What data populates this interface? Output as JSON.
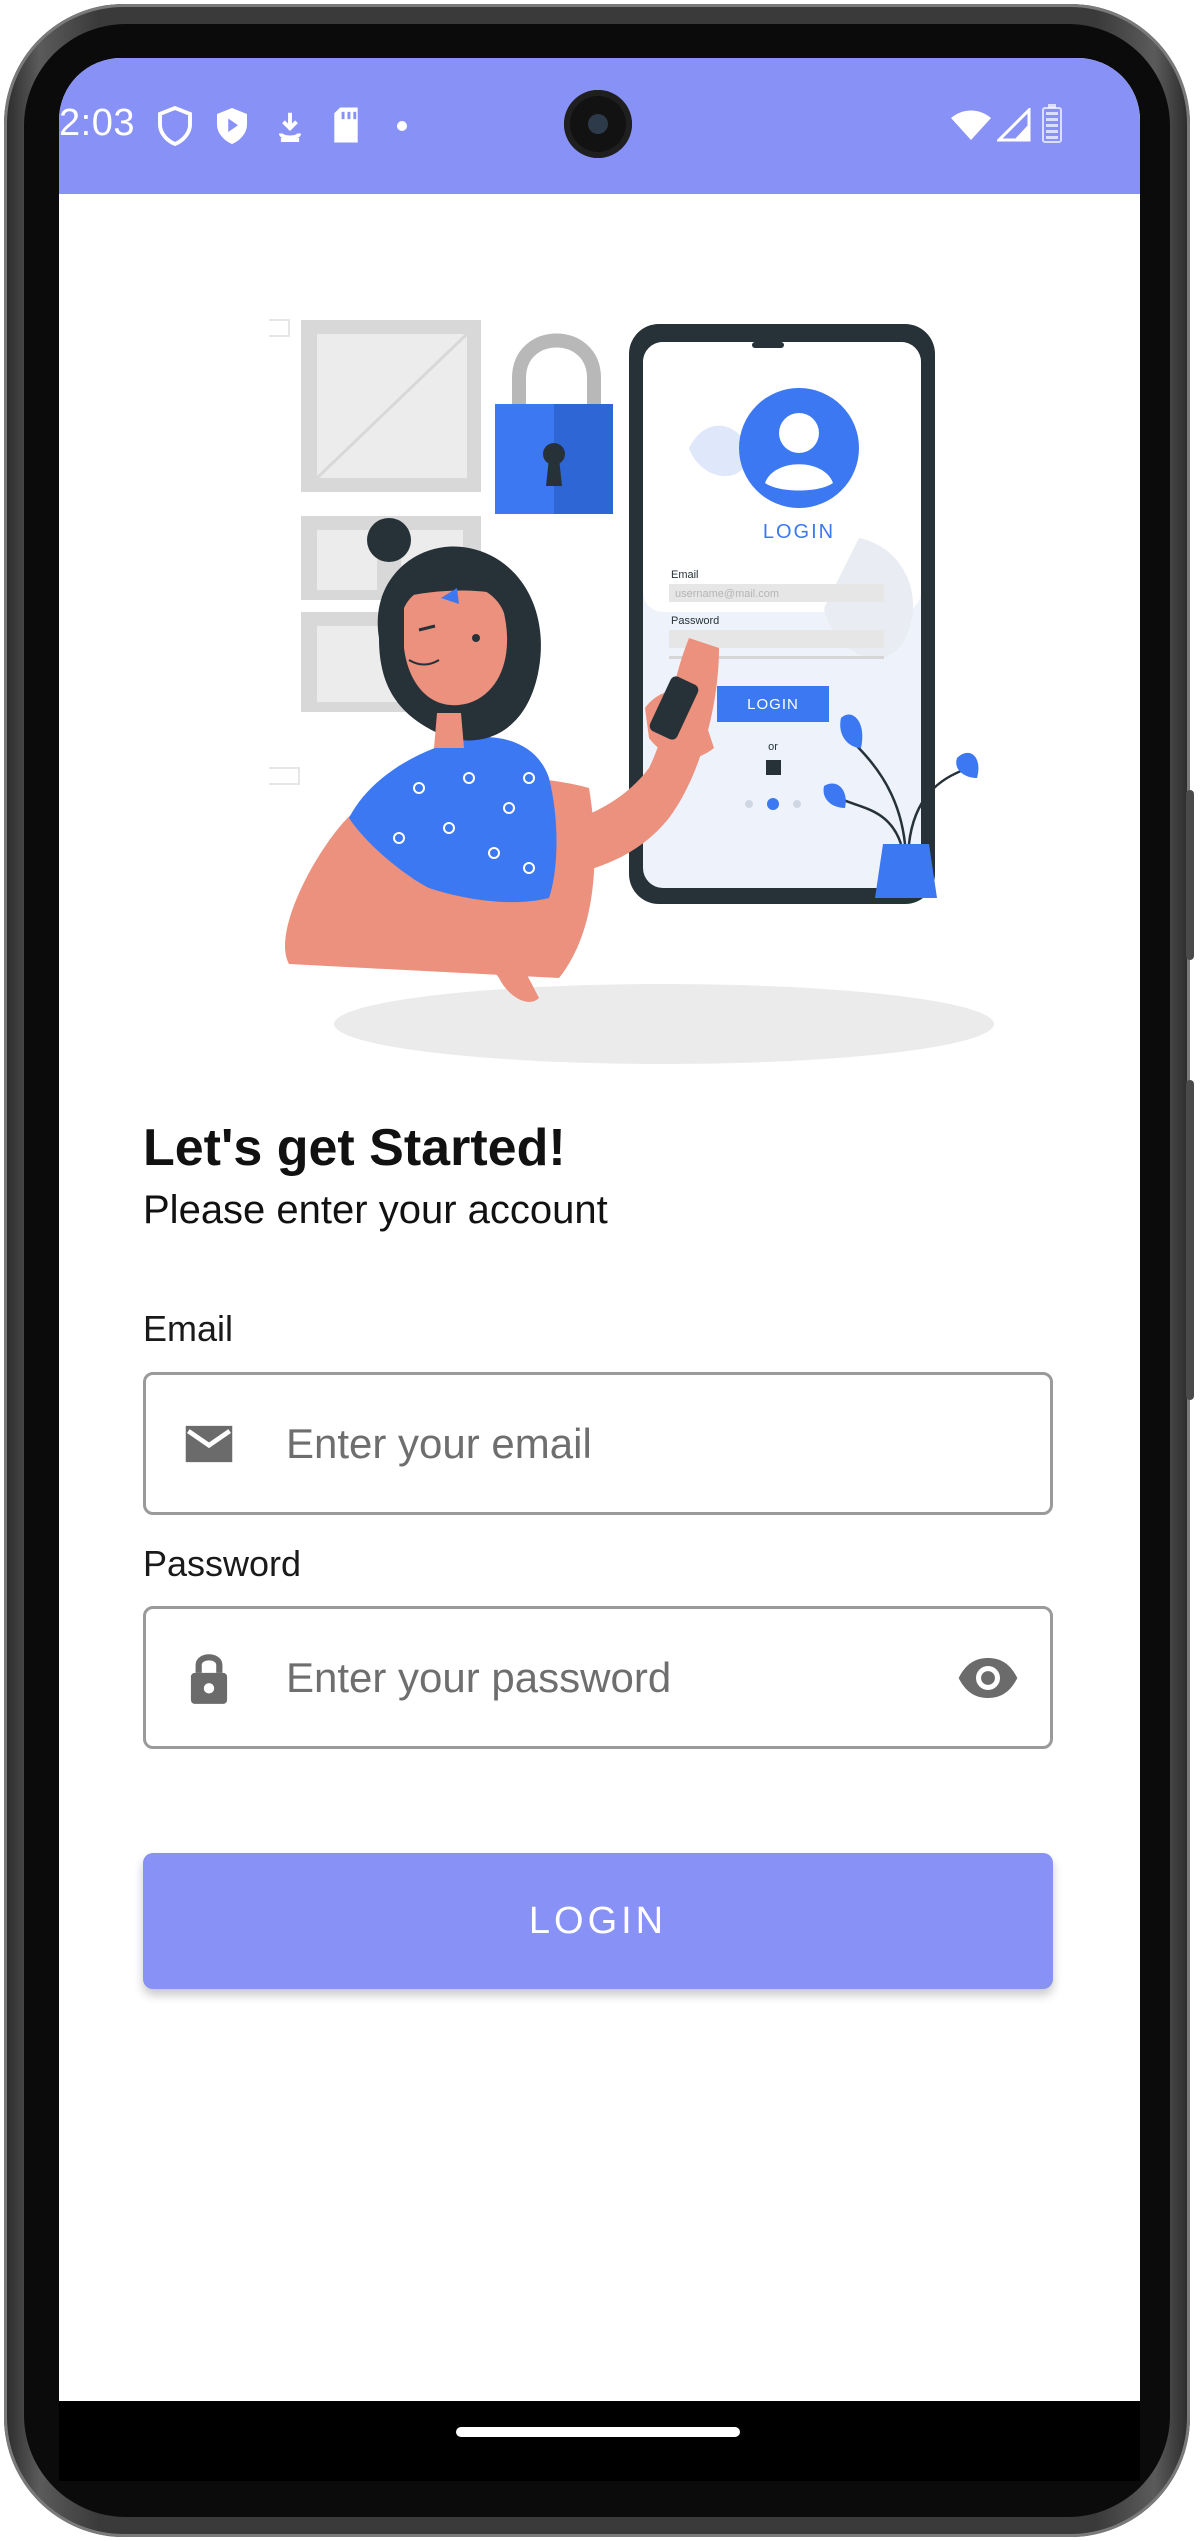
{
  "status_bar": {
    "time": "2:03",
    "left_icons": [
      "shield-icon",
      "play-shield-icon",
      "download-icon",
      "sd-card-icon",
      "dot-icon"
    ],
    "right_icons": [
      "wifi-icon",
      "signal-icon",
      "battery-icon"
    ],
    "background_color": "#8891f5"
  },
  "illustration": {
    "phone_login_label": "LOGIN",
    "phone_email_label": "Email",
    "phone_email_value": "username@mail.com",
    "phone_password_label": "Password",
    "phone_button_label": "LOGIN",
    "phone_or_label": "or",
    "accent_color": "#3b78f2"
  },
  "form": {
    "title": "Let's get Started!",
    "subtitle": "Please enter your account",
    "email": {
      "label": "Email",
      "placeholder": "Enter your email",
      "value": "",
      "icon": "mail-icon"
    },
    "password": {
      "label": "Password",
      "placeholder": "Enter your password",
      "value": "",
      "icon": "lock-icon",
      "toggle_icon": "eye-icon"
    },
    "login_button": "LOGIN"
  },
  "colors": {
    "primary": "#8891f5",
    "icon_gray": "#6b6b6b"
  }
}
